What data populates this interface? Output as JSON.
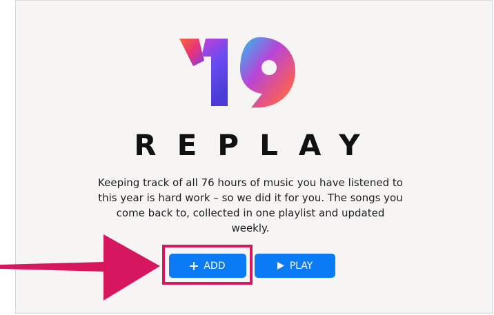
{
  "logo": {
    "alt": "'19 Replay logo"
  },
  "title": "REPLAY",
  "description": "Keeping track of all 76 hours of music you have listened to this year is hard work – so we did it for you. The songs you come back to, collected in one playlist and updated weekly.",
  "buttons": {
    "add_label": "ADD",
    "add_icon": "plus-icon",
    "play_label": "PLAY",
    "play_icon": "play-icon"
  },
  "colors": {
    "accent": "#0a7bf4",
    "highlight": "#d6165f",
    "background": "#f6f5f3",
    "text": "#111111"
  }
}
